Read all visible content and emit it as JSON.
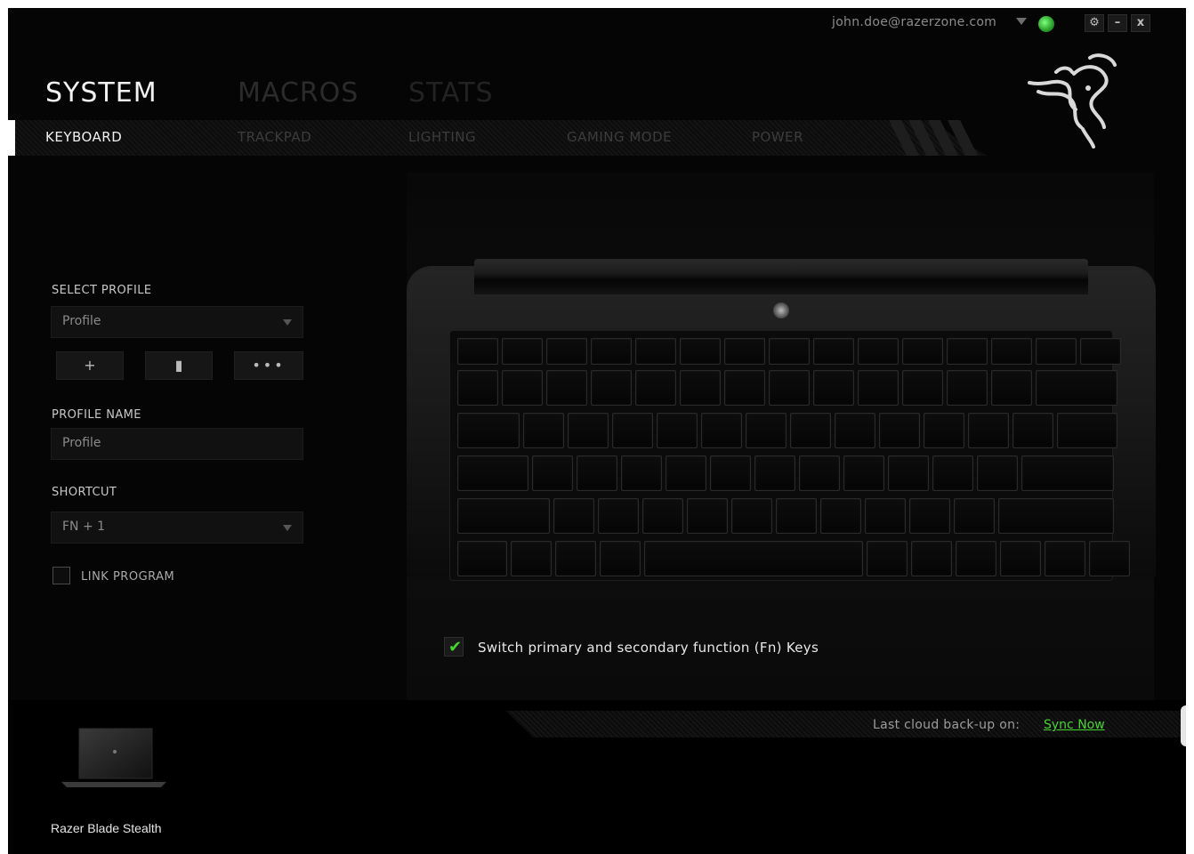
{
  "titlebar": {
    "account_email": "john.doe@razerzone.com",
    "settings_glyph": "⚙",
    "minimize_glyph": "–",
    "close_glyph": "x"
  },
  "main_tabs": [
    "SYSTEM",
    "MACROS",
    "STATS"
  ],
  "sub_tabs": [
    "KEYBOARD",
    "TRACKPAD",
    "LIGHTING",
    "GAMING MODE",
    "POWER"
  ],
  "left_panel": {
    "select_profile_label": "SELECT PROFILE",
    "profile_value": "Profile",
    "add_glyph": "+",
    "delete_glyph": "▮",
    "more_glyph": "•••",
    "profile_name_label": "PROFILE NAME",
    "profile_name_value": "Profile",
    "shortcut_label": "SHORTCUT",
    "shortcut_value": "FN + 1",
    "link_program_label": "LINK PROGRAM",
    "link_program_checked": false
  },
  "keyboard": {
    "fn_switch_label": "Switch primary and secondary function (Fn) Keys",
    "fn_switch_checked": true
  },
  "footer": {
    "backup_label": "Last cloud back-up on:",
    "sync_label": "Sync Now",
    "device_name": "Razer Blade Stealth"
  },
  "colors": {
    "accent": "#44d62c",
    "background": "#050505"
  }
}
